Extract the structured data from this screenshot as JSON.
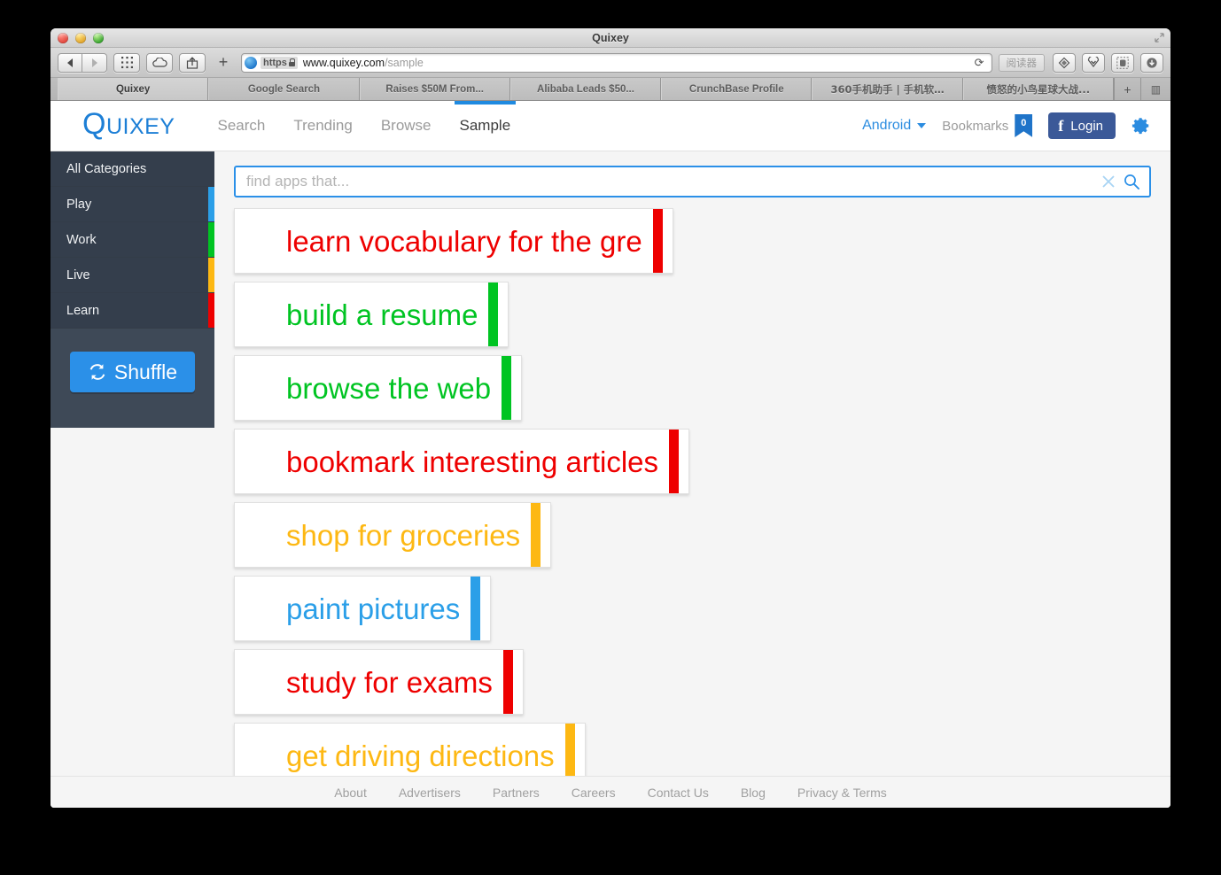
{
  "window": {
    "title": "Quixey",
    "traffic_lights": [
      "close",
      "minimize",
      "zoom"
    ]
  },
  "browser": {
    "url_scheme_chip": "https",
    "url_host": "www.quixey.com",
    "url_path": "/sample",
    "reader_button": "阅读器",
    "reload_glyph": "⟳",
    "new_tab_glyph": "+",
    "back_glyph": "◀",
    "forward_glyph": "▶",
    "tabs": [
      {
        "label": "Quixey",
        "active": true,
        "cjk": false
      },
      {
        "label": "Google Search",
        "active": false,
        "cjk": false
      },
      {
        "label": "Raises $50M From...",
        "active": false,
        "cjk": false
      },
      {
        "label": "Alibaba Leads $50...",
        "active": false,
        "cjk": false
      },
      {
        "label": "CrunchBase Profile",
        "active": false,
        "cjk": false
      },
      {
        "label": "360手机助手 | 手机软…",
        "active": false,
        "cjk": true
      },
      {
        "label": "愤怒的小鸟星球大战...",
        "active": false,
        "cjk": true
      }
    ],
    "tab_add_glyph": "+",
    "tab_overview_glyph": "▥"
  },
  "header": {
    "logo_cap": "Q",
    "logo_rest": "UIXEY",
    "nav": [
      {
        "label": "Search",
        "active": false
      },
      {
        "label": "Trending",
        "active": false
      },
      {
        "label": "Browse",
        "active": false
      },
      {
        "label": "Sample",
        "active": true
      }
    ],
    "platform": "Android",
    "bookmarks_label": "Bookmarks",
    "bookmarks_count": "0",
    "login_label": "Login",
    "settings_icon": "gear-icon"
  },
  "sidebar": {
    "categories": [
      {
        "label": "All Categories",
        "accent": ""
      },
      {
        "label": "Play",
        "accent": "#2B9FE8"
      },
      {
        "label": "Work",
        "accent": "#00C422"
      },
      {
        "label": "Live",
        "accent": "#FDB813"
      },
      {
        "label": "Learn",
        "accent": "#EE0000"
      }
    ],
    "shuffle_label": "Shuffle"
  },
  "search": {
    "value": "",
    "placeholder": "find apps that...",
    "clear_icon": "close-icon",
    "search_icon": "search-icon"
  },
  "results": [
    {
      "text": "learn vocabulary for the gre",
      "color": "#EE0000"
    },
    {
      "text": "build a resume",
      "color": "#00C422"
    },
    {
      "text": "browse the web",
      "color": "#00C422"
    },
    {
      "text": "bookmark interesting articles",
      "color": "#EE0000"
    },
    {
      "text": "shop for groceries",
      "color": "#FDB813"
    },
    {
      "text": "paint pictures",
      "color": "#2B9FE8"
    },
    {
      "text": "study for exams",
      "color": "#EE0000"
    },
    {
      "text": "get driving directions",
      "color": "#FDB813"
    }
  ],
  "footer": {
    "links": [
      "About",
      "Advertisers",
      "Partners",
      "Careers",
      "Contact Us",
      "Blog",
      "Privacy & Terms"
    ]
  },
  "colors": {
    "brand_blue": "#1D7FD6",
    "accent_blue": "#2B90E8",
    "facebook": "#3B5998",
    "sidebar_bg": "#3E4957",
    "red": "#EE0000",
    "green": "#00C422",
    "amber": "#FDB813",
    "blue": "#2B9FE8"
  }
}
